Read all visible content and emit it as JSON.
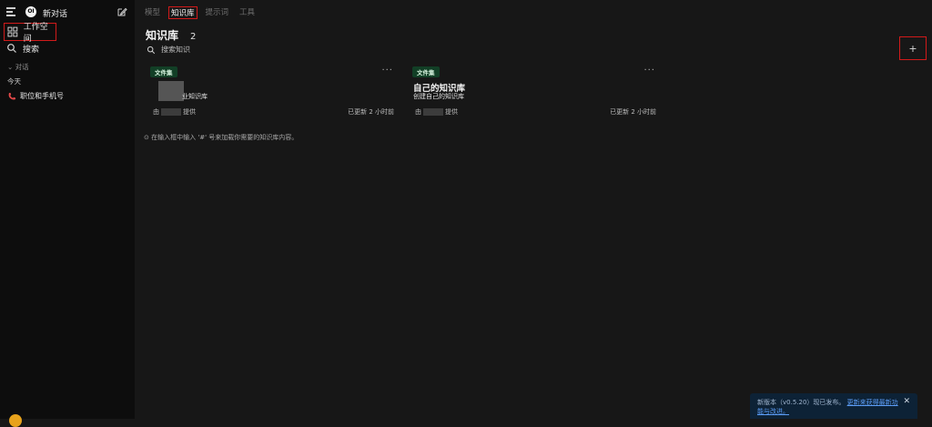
{
  "sidebar": {
    "logo_text": "OI",
    "new_chat_label": "新对话",
    "workspace_label": "工作空间",
    "search_label": "搜索",
    "chat_group_label": "对话",
    "today_label": "今天",
    "chat_items": [
      {
        "label": "职位和手机号"
      }
    ]
  },
  "main": {
    "tabs": [
      {
        "label": "模型",
        "active": false
      },
      {
        "label": "知识库",
        "active": true
      },
      {
        "label": "提示词",
        "active": false
      },
      {
        "label": "工具",
        "active": false
      }
    ],
    "title": "知识库",
    "count": "2",
    "search_placeholder": "搜索知识",
    "add_label": "+",
    "cards": [
      {
        "badge": "文件集",
        "name": "",
        "description": "业知识库",
        "author_prefix": "由",
        "author_suffix": "提供",
        "updated": "已更新 2 小时前"
      },
      {
        "badge": "文件集",
        "name": "自己的知识库",
        "description": "创建自己的知识库",
        "author_prefix": "由",
        "author_suffix": "提供",
        "updated": "已更新 2 小时前"
      }
    ],
    "hint": "在输入框中输入 '#' 号来加载你需要的知识库内容。"
  },
  "toast": {
    "text": "新版本（v0.5.20）现已发布。",
    "link": "更新来获得最新功能与改进。",
    "close": "✕"
  },
  "colors": {
    "sidebar_bg": "#0d0d0d",
    "main_bg": "#171717",
    "badge_bg": "#123f26",
    "highlight_border": "#d11a1a",
    "toast_bg": "#0d2236",
    "link": "#5b9cf5"
  }
}
